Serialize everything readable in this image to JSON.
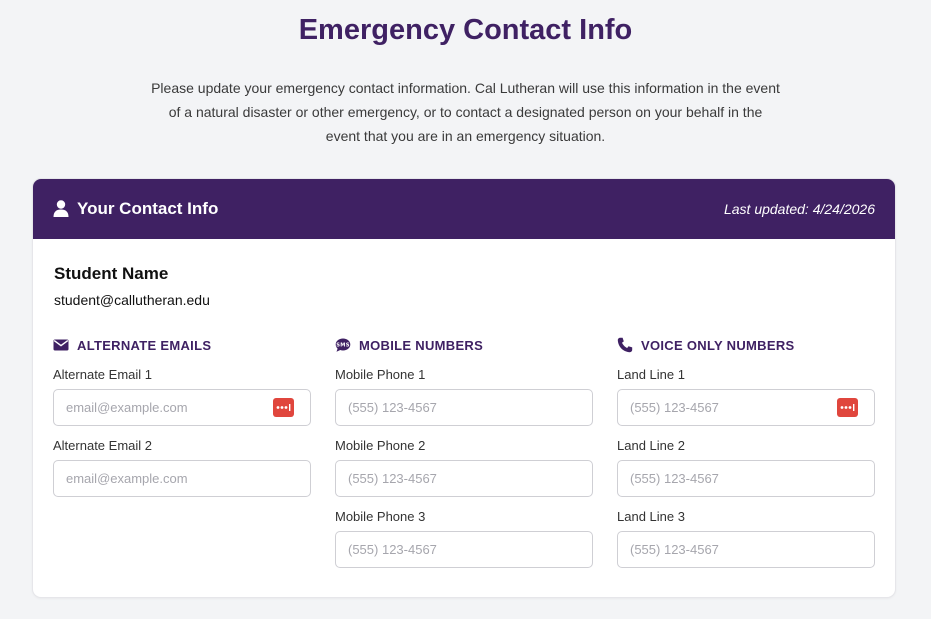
{
  "page": {
    "title": "Emergency Contact Info",
    "intro": "Please update your emergency contact information. Cal Lutheran will use this information in the event of a natural disaster or other emergency, or to contact a designated person on your behalf in the event that you are in an emergency situation."
  },
  "card": {
    "title": "Your Contact Info",
    "last_updated": "Last updated: 4/24/2026",
    "student_name": "Student Name",
    "student_email": "student@callutheran.edu"
  },
  "sections": {
    "emails": {
      "heading": "ALTERNATE EMAILS",
      "icon": "envelope-icon",
      "fields": [
        {
          "label": "Alternate Email 1",
          "placeholder": "email@example.com",
          "value": ""
        },
        {
          "label": "Alternate Email 2",
          "placeholder": "email@example.com",
          "value": ""
        }
      ]
    },
    "mobile": {
      "heading": "MOBILE NUMBERS",
      "icon": "sms-icon",
      "fields": [
        {
          "label": "Mobile Phone 1",
          "placeholder": "(555) 123-4567",
          "value": ""
        },
        {
          "label": "Mobile Phone 2",
          "placeholder": "(555) 123-4567",
          "value": ""
        },
        {
          "label": "Mobile Phone 3",
          "placeholder": "(555) 123-4567",
          "value": ""
        }
      ]
    },
    "voice": {
      "heading": "VOICE ONLY NUMBERS",
      "icon": "phone-icon",
      "fields": [
        {
          "label": "Land Line 1",
          "placeholder": "(555) 123-4567",
          "value": ""
        },
        {
          "label": "Land Line 2",
          "placeholder": "(555) 123-4567",
          "value": ""
        },
        {
          "label": "Land Line 3",
          "placeholder": "(555) 123-4567",
          "value": ""
        }
      ]
    }
  },
  "colors": {
    "brand": "#3f2163",
    "background": "#f3f4f6",
    "password_manager_icon": "#e0463d"
  }
}
